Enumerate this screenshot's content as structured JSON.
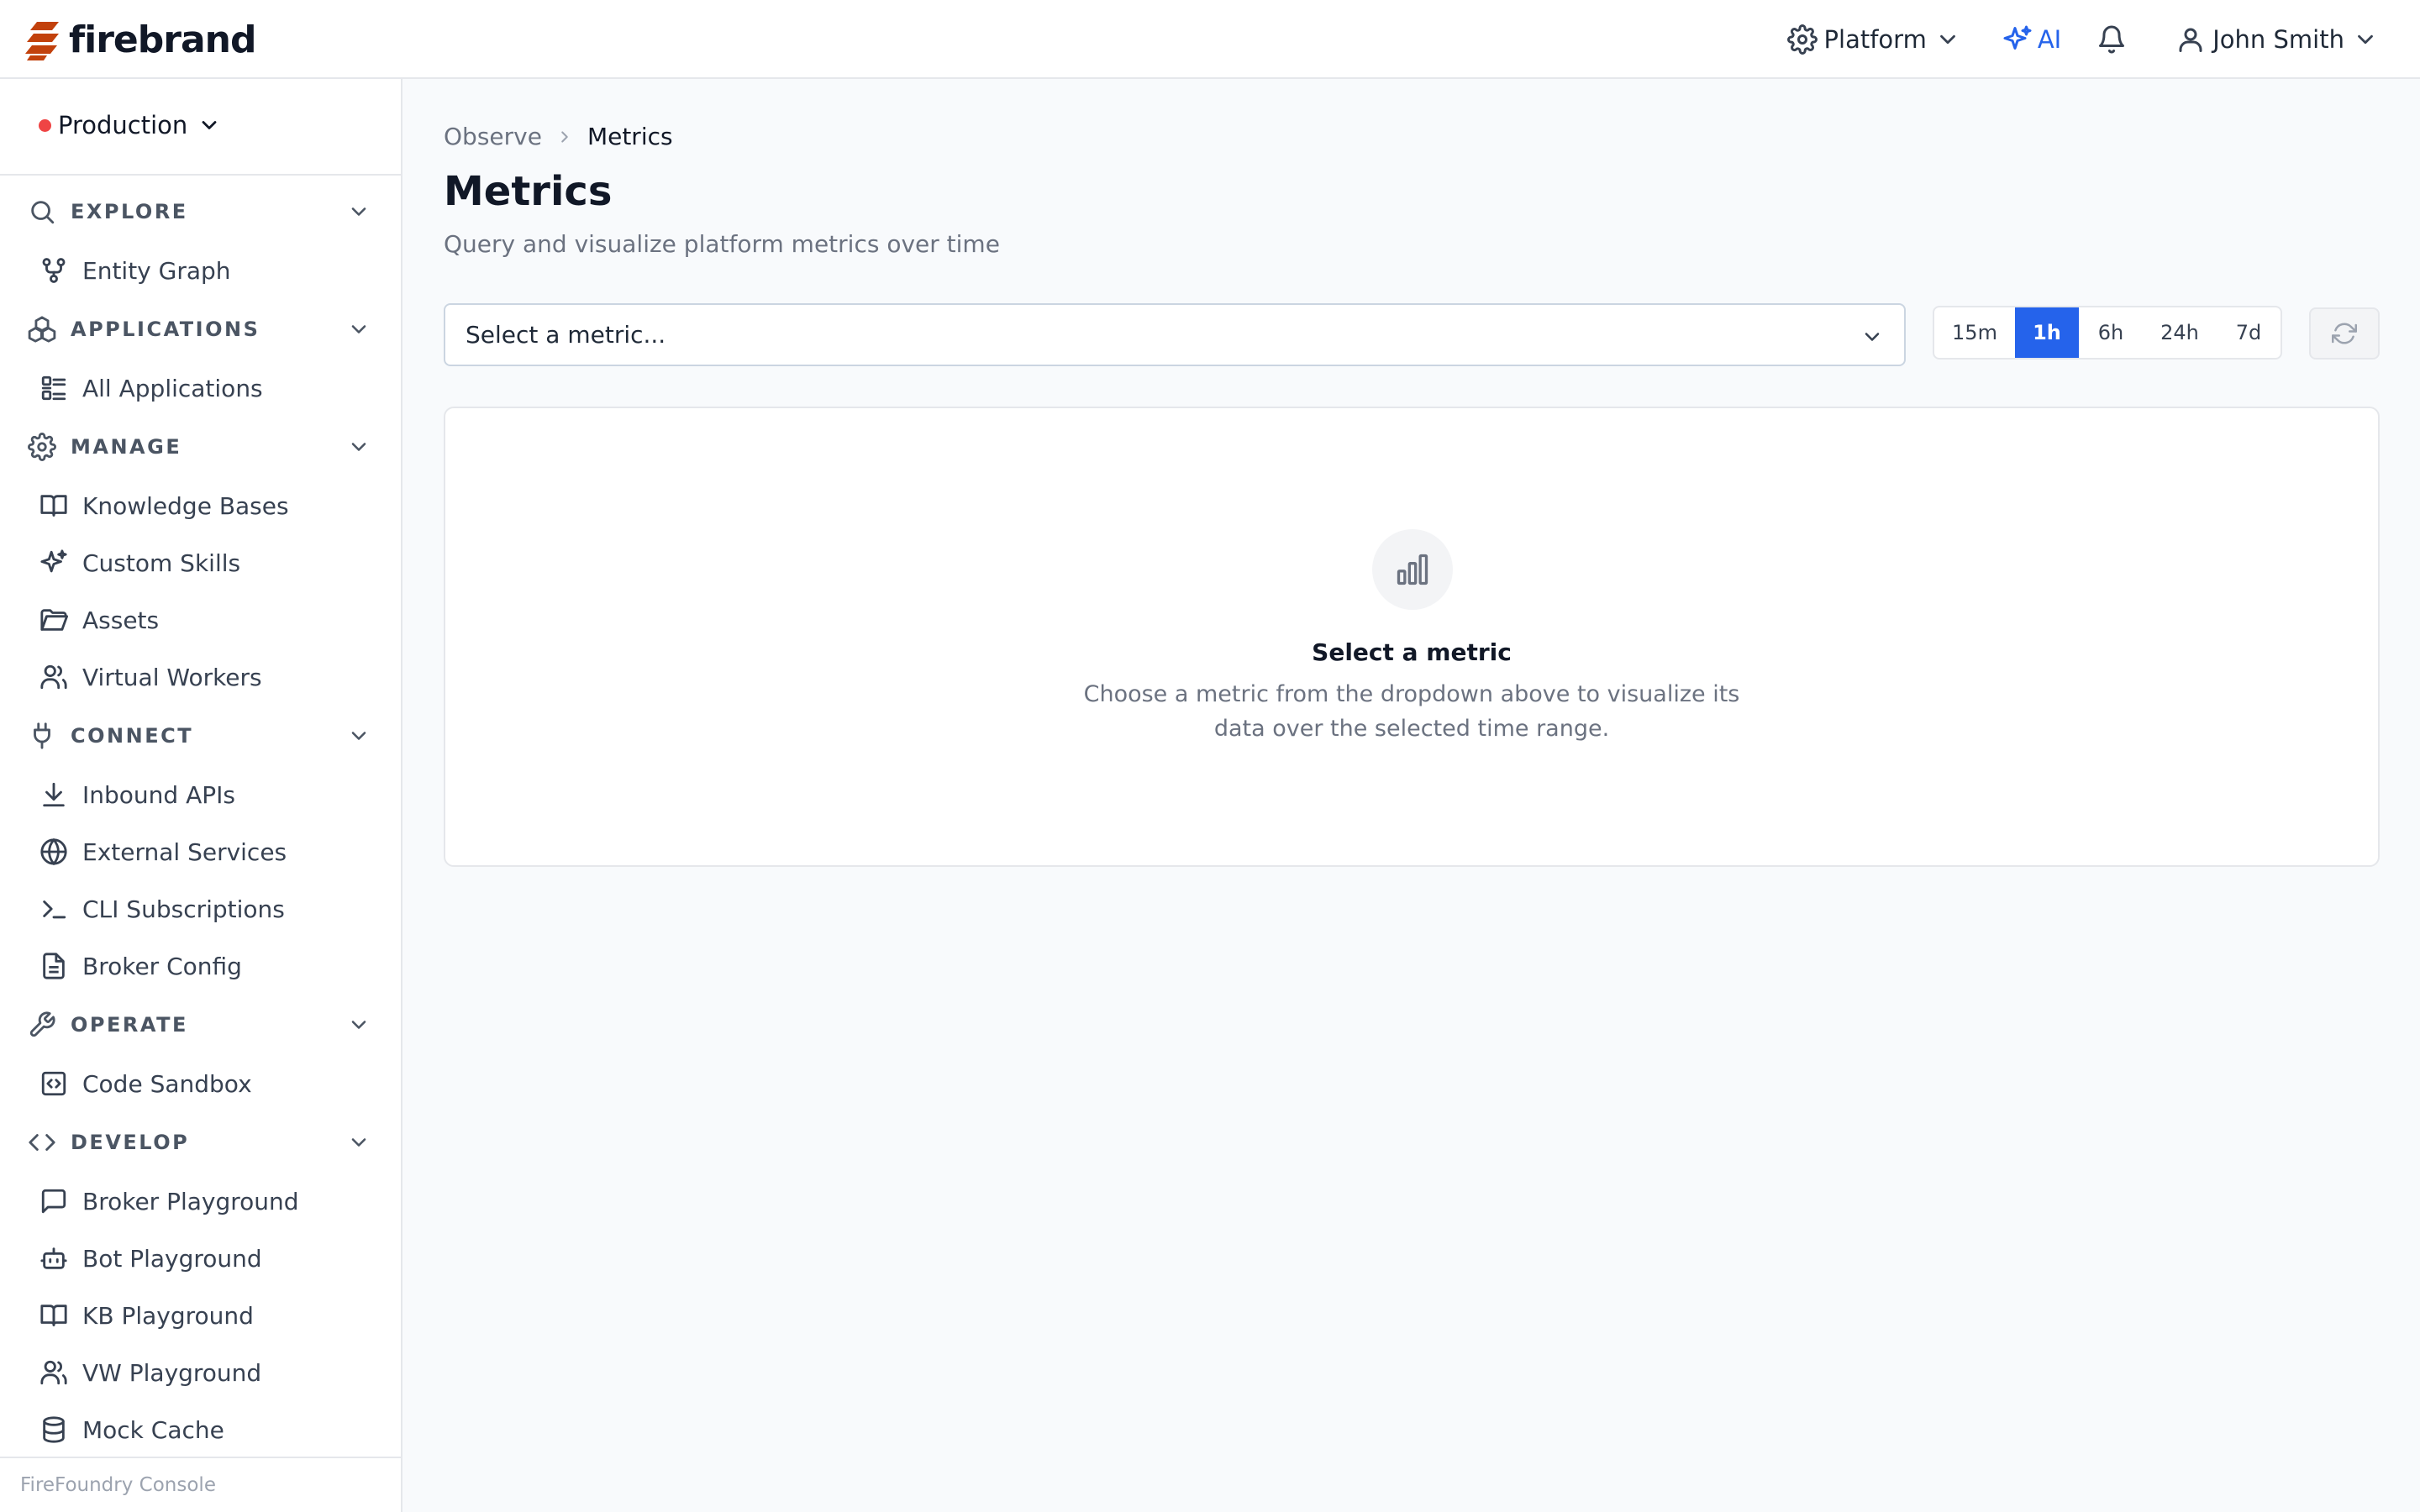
{
  "header": {
    "logo_text": "firebrand",
    "platform_label": "Platform",
    "ai_label": "AI",
    "user_name": "John Smith",
    "brand_color": "#c2410c",
    "accent_color": "#2563eb"
  },
  "sidebar": {
    "environment": {
      "label": "Production",
      "status_color": "#ef4444"
    },
    "sections": [
      {
        "label": "EXPLORE",
        "icon": "search-icon",
        "items": [
          {
            "label": "Entity Graph",
            "icon": "graph-icon"
          }
        ]
      },
      {
        "label": "APPLICATIONS",
        "icon": "cubes-icon",
        "items": [
          {
            "label": "All Applications",
            "icon": "list-icon"
          }
        ]
      },
      {
        "label": "MANAGE",
        "icon": "gear-icon",
        "items": [
          {
            "label": "Knowledge Bases",
            "icon": "book-icon"
          },
          {
            "label": "Custom Skills",
            "icon": "sparkles-icon"
          },
          {
            "label": "Assets",
            "icon": "folder-icon"
          },
          {
            "label": "Virtual Workers",
            "icon": "users-icon"
          }
        ]
      },
      {
        "label": "CONNECT",
        "icon": "plug-icon",
        "items": [
          {
            "label": "Inbound APIs",
            "icon": "download-icon"
          },
          {
            "label": "External Services",
            "icon": "globe-icon"
          },
          {
            "label": "CLI Subscriptions",
            "icon": "terminal-icon"
          },
          {
            "label": "Broker Config",
            "icon": "file-icon"
          }
        ]
      },
      {
        "label": "OPERATE",
        "icon": "wrench-icon",
        "items": [
          {
            "label": "Code Sandbox",
            "icon": "code-box-icon"
          }
        ]
      },
      {
        "label": "DEVELOP",
        "icon": "code-icon",
        "items": [
          {
            "label": "Broker Playground",
            "icon": "chat-icon"
          },
          {
            "label": "Bot Playground",
            "icon": "bot-icon"
          },
          {
            "label": "KB Playground",
            "icon": "book-icon"
          },
          {
            "label": "VW Playground",
            "icon": "users-icon"
          },
          {
            "label": "Mock Cache",
            "icon": "database-icon"
          }
        ]
      }
    ],
    "footer": "FireFoundry Console"
  },
  "main": {
    "breadcrumb": {
      "parent": "Observe",
      "current": "Metrics"
    },
    "title": "Metrics",
    "subtitle": "Query and visualize platform metrics over time",
    "metric_select": {
      "placeholder": "Select a metric..."
    },
    "time_ranges": [
      "15m",
      "1h",
      "6h",
      "24h",
      "7d"
    ],
    "selected_range": "1h",
    "empty_state": {
      "icon": "bar-chart-icon",
      "title": "Select a metric",
      "line1": "Choose a metric from the dropdown above to visualize its",
      "line2": "data over the selected time range."
    }
  }
}
